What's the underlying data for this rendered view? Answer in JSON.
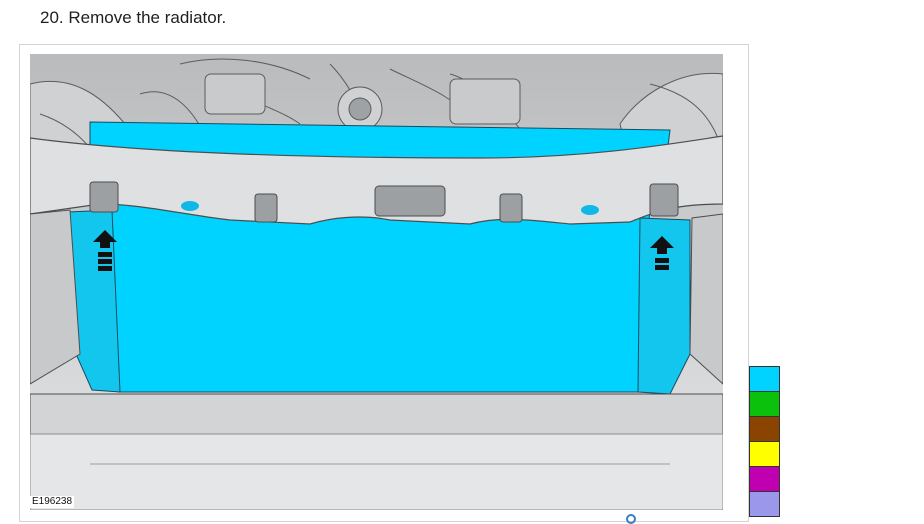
{
  "step": {
    "text": "20. Remove the radiator."
  },
  "figure": {
    "id": "E196238"
  },
  "legend": {
    "colors": [
      "#00d3ff",
      "#0bc10b",
      "#8b4300",
      "#ffff00",
      "#c000b0",
      "#9b97ea"
    ]
  },
  "illustration": {
    "highlight_color": "#00d3ff",
    "icons": [
      "up-arrow-icon",
      "up-arrow-icon",
      "loading-indicator-icon"
    ]
  }
}
